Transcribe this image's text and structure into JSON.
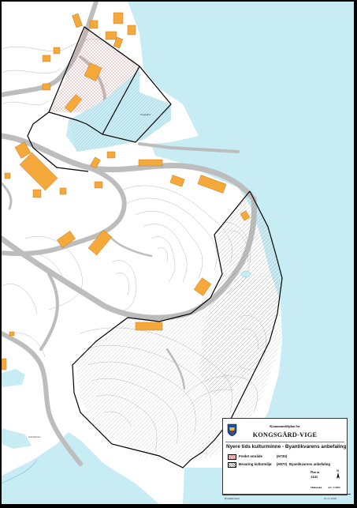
{
  "legend": {
    "plan_label": "Kommunedelplan for",
    "plan_title": "KONGSGÅRD-VIGE",
    "subtitle": "Nyere tids kulturminne - Byantikvarens anbefaling",
    "items": [
      {
        "label": "Fredet område",
        "code": "(H730)",
        "swatch": "cross-hatch-pink"
      },
      {
        "label": "Bevaring kulturmiljø",
        "code": "(H570)",
        "note": "Byantikvarens anbefaling",
        "swatch": "diagonal-hatch"
      }
    ],
    "plan_number_label": "Plan nr",
    "plan_number": "1441",
    "scale_label": "Målestokk",
    "scale": "A3= 1:5000"
  },
  "footer": {
    "left": "Byantikvaren",
    "date": "01.11.2016"
  },
  "map_labels": {
    "label_a": "Kongsgård",
    "label_b": "Grimsholmen"
  },
  "colors": {
    "water": "#c8ecf4",
    "buildings": "#f5a93a",
    "roads": "#bcbcbc",
    "contours": "#9a9a9a",
    "boundary": "#000000",
    "protected_hatch": "#d47a7a"
  }
}
